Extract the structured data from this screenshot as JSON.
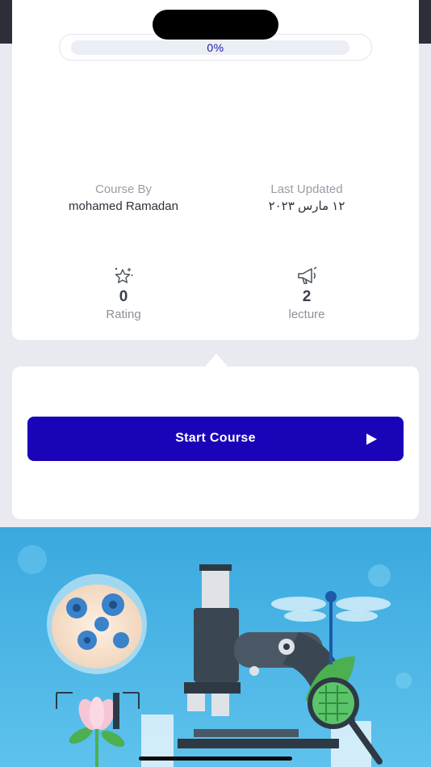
{
  "progress": {
    "value": 0,
    "label": "0%"
  },
  "meta": {
    "course_by_label": "Course By",
    "course_by_value": "mohamed Ramadan",
    "last_updated_label": "Last Updated",
    "last_updated_value": "١٢ مارس ٢٠٢٣"
  },
  "stats": {
    "rating": {
      "value": "0",
      "label": "Rating",
      "icon": "sparkle-star-icon"
    },
    "lectures": {
      "value": "2",
      "label": "lecture",
      "icon": "megaphone-icon"
    }
  },
  "actions": {
    "start_label": "Start Course",
    "play_icon": "play-icon"
  },
  "hero": {
    "image": "biology-microscope-illustration"
  },
  "colors": {
    "accent": "#1a04b8",
    "card": "#ffffff",
    "background": "#e9e9f0",
    "hero_sky": "#3aa6dc"
  }
}
